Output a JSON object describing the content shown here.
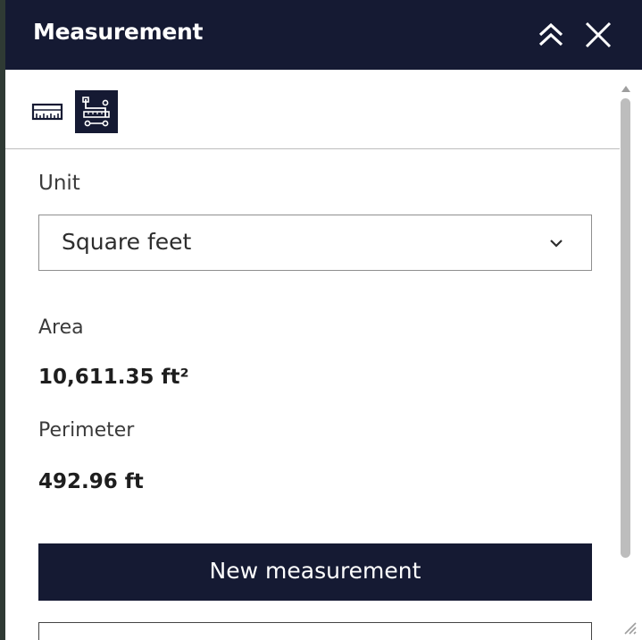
{
  "header": {
    "title": "Measurement",
    "collapse_icon": "double-chevron-up-icon",
    "close_icon": "close-icon"
  },
  "tools": [
    {
      "name": "distance",
      "icon": "ruler-icon",
      "active": false
    },
    {
      "name": "area",
      "icon": "area-measure-icon",
      "active": true
    }
  ],
  "unit": {
    "label": "Unit",
    "selected": "Square feet"
  },
  "results": {
    "area_label": "Area",
    "area_value": "10,611.35 ft²",
    "perimeter_label": "Perimeter",
    "perimeter_value": "492.96 ft"
  },
  "actions": {
    "new_measurement_label": "New measurement"
  },
  "colors": {
    "header_bg": "#151a33",
    "button_bg": "#151a33",
    "text": "#1e1e1e",
    "scrollbar": "#bdbdbd"
  }
}
